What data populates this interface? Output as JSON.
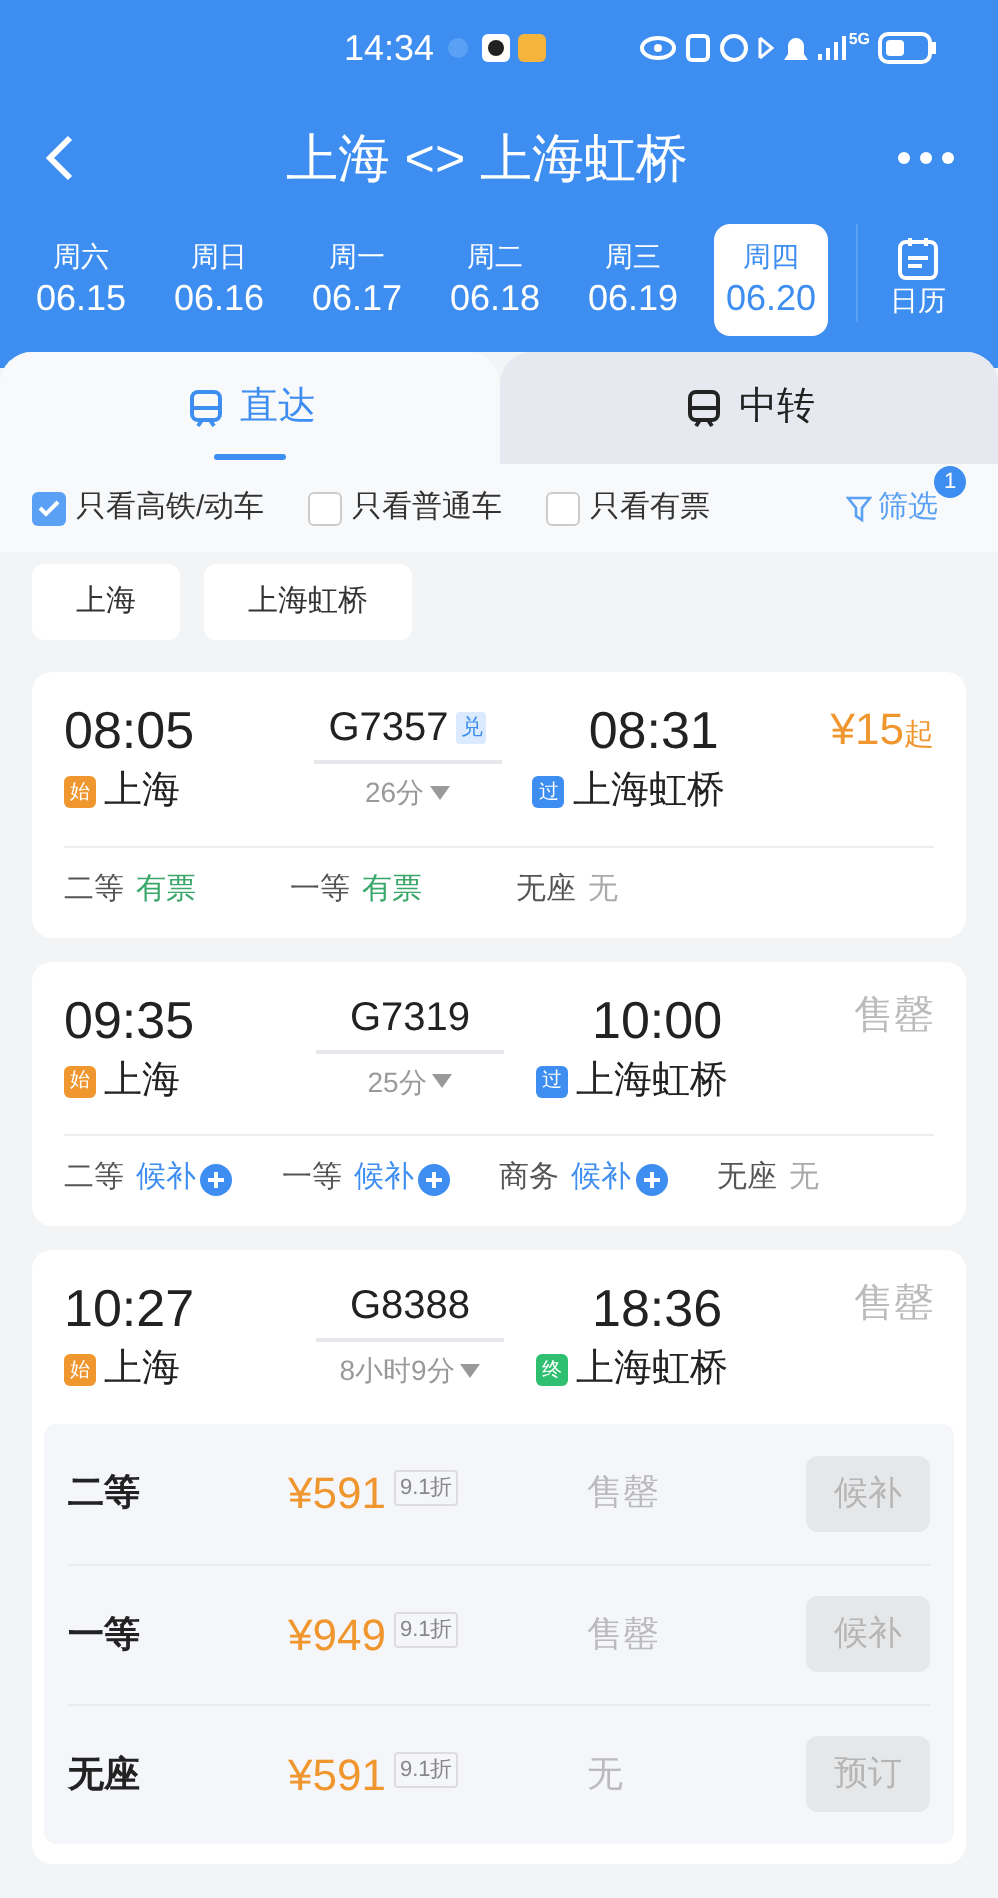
{
  "status_bar": {
    "time": "14:34",
    "network": "5G"
  },
  "header": {
    "title": "上海 <> 上海虹桥"
  },
  "dates": [
    {
      "weekday": "周六",
      "date": "06.15",
      "selected": false
    },
    {
      "weekday": "周日",
      "date": "06.16",
      "selected": false
    },
    {
      "weekday": "周一",
      "date": "06.17",
      "selected": false
    },
    {
      "weekday": "周二",
      "date": "06.18",
      "selected": false
    },
    {
      "weekday": "周三",
      "date": "06.19",
      "selected": false
    },
    {
      "weekday": "周四",
      "date": "06.20",
      "selected": true
    }
  ],
  "calendar_button": "日历",
  "tabs": [
    {
      "label": "直达",
      "selected": true
    },
    {
      "label": "中转",
      "selected": false
    }
  ],
  "filters": [
    {
      "label": "只看高铁/动车",
      "checked": true
    },
    {
      "label": "只看普通车",
      "checked": false
    },
    {
      "label": "只看有票",
      "checked": false
    }
  ],
  "filter_button": {
    "label": "筛选",
    "badge": "1"
  },
  "stations": [
    "上海",
    "上海虹桥"
  ],
  "trains": [
    {
      "kind": "summary",
      "depart_time": "08:05",
      "depart_station": "上海",
      "depart_badge": {
        "text": "始",
        "color": "#f0962e"
      },
      "number": "G7357",
      "number_tag": "兑",
      "duration": "26分",
      "arrive_time": "08:31",
      "arrive_station": "上海虹桥",
      "arrive_badge": {
        "text": "过",
        "color": "#3d8ef0"
      },
      "price": "¥15",
      "price_suffix": "起",
      "seats": [
        {
          "name": "二等",
          "status": "有票",
          "kind": "available"
        },
        {
          "name": "一等",
          "status": "有票",
          "kind": "available"
        },
        {
          "name": "无座",
          "status": "无",
          "kind": "none"
        }
      ]
    },
    {
      "kind": "summary",
      "depart_time": "09:35",
      "depart_station": "上海",
      "depart_badge": {
        "text": "始",
        "color": "#f0962e"
      },
      "number": "G7319",
      "duration": "25分",
      "arrive_time": "10:00",
      "arrive_station": "上海虹桥",
      "arrive_badge": {
        "text": "过",
        "color": "#3d8ef0"
      },
      "sold_out": "售罄",
      "seats": [
        {
          "name": "二等",
          "status": "候补",
          "kind": "waitlist"
        },
        {
          "name": "一等",
          "status": "候补",
          "kind": "waitlist"
        },
        {
          "name": "商务",
          "status": "候补",
          "kind": "waitlist"
        },
        {
          "name": "无座",
          "status": "无",
          "kind": "none"
        }
      ]
    },
    {
      "kind": "expanded",
      "depart_time": "10:27",
      "depart_station": "上海",
      "depart_badge": {
        "text": "始",
        "color": "#f0962e"
      },
      "number": "G8388",
      "duration": "8小时9分",
      "arrive_time": "18:36",
      "arrive_station": "上海虹桥",
      "arrive_badge": {
        "text": "终",
        "color": "#2fbf71"
      },
      "sold_out": "售罄",
      "fares": [
        {
          "seat": "二等",
          "price": "¥591",
          "discount": "9.1折",
          "status": "售罄",
          "action": "候补"
        },
        {
          "seat": "一等",
          "price": "¥949",
          "discount": "9.1折",
          "status": "售罄",
          "action": "候补"
        },
        {
          "seat": "无座",
          "price": "¥591",
          "discount": "9.1折",
          "status": "无",
          "action": "预订"
        }
      ]
    }
  ]
}
